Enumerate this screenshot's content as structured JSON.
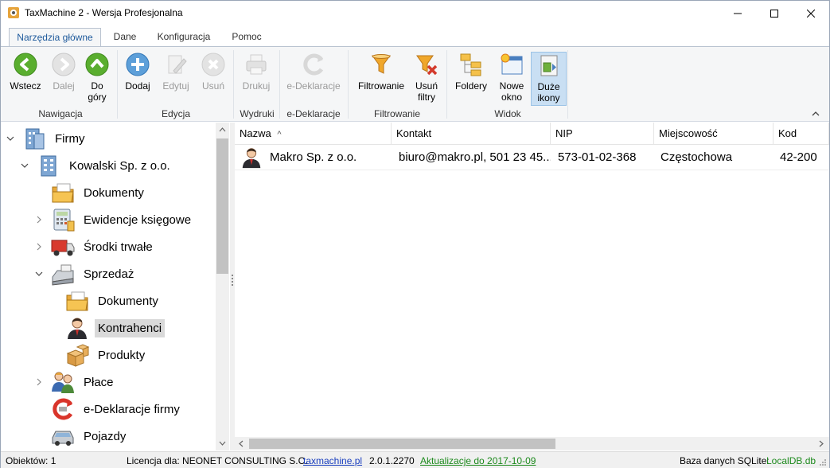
{
  "window": {
    "title": "TaxMachine 2  -  Wersja Profesjonalna"
  },
  "tabs": [
    {
      "label": "Narzędzia główne",
      "active": true
    },
    {
      "label": "Dane",
      "active": false
    },
    {
      "label": "Konfiguracja",
      "active": false
    },
    {
      "label": "Pomoc",
      "active": false
    }
  ],
  "ribbon": {
    "nawigacja": {
      "group": "Nawigacja",
      "back": "Wstecz",
      "forward": "Dalej",
      "up_l1": "Do",
      "up_l2": "góry"
    },
    "edycja": {
      "group": "Edycja",
      "add": "Dodaj",
      "edit": "Edytuj",
      "delete": "Usuń"
    },
    "wydruki": {
      "group": "Wydruki",
      "print": "Drukuj"
    },
    "edeklaracje": {
      "group": "e-Deklaracje",
      "button": "e-Deklaracje"
    },
    "filtrowanie": {
      "group": "Filtrowanie",
      "filter": "Filtrowanie",
      "remove_l1": "Usuń",
      "remove_l2": "filtry"
    },
    "widok": {
      "group": "Widok",
      "folders": "Foldery",
      "new_l1": "Nowe",
      "new_l2": "okno",
      "large_l1": "Duże",
      "large_l2": "ikony"
    }
  },
  "tree": {
    "firmy": "Firmy",
    "company": "Kowalski Sp. z o.o.",
    "dokumenty": "Dokumenty",
    "ewidencje": "Ewidencje księgowe",
    "srodki": "Środki trwałe",
    "sprzedaz": "Sprzedaż",
    "sprzedaz_dokumenty": "Dokumenty",
    "kontrahenci": "Kontrahenci",
    "produkty": "Produkty",
    "place": "Płace",
    "edeklaracje_firmy": "e-Deklaracje firmy",
    "pojazdy": "Pojazdy"
  },
  "grid": {
    "columns": [
      "Nazwa",
      "Kontakt",
      "NIP",
      "Miejscowość",
      "Kod"
    ],
    "sort_indicator": "^",
    "rows": [
      {
        "nazwa": "Makro Sp. z o.o.",
        "kontakt": "biuro@makro.pl, 501 23 45...",
        "nip": "573-01-02-368",
        "miejscowosc": "Częstochowa",
        "kod": "42-200"
      }
    ]
  },
  "status": {
    "objects": "Obiektów: 1",
    "license": "Licencja dla: NEONET CONSULTING S.C.",
    "site": "taxmachine.pl",
    "version": "2.0.1.2270",
    "updates": "Aktualizacje do 2017-10-09",
    "db_label": "Baza danych SQLite:",
    "db_file": "LocalDB.db"
  },
  "colors": {
    "accent": "#1e5a9c",
    "selected_ribbon": "#c9dff3",
    "green_link": "#1d8a1d"
  }
}
